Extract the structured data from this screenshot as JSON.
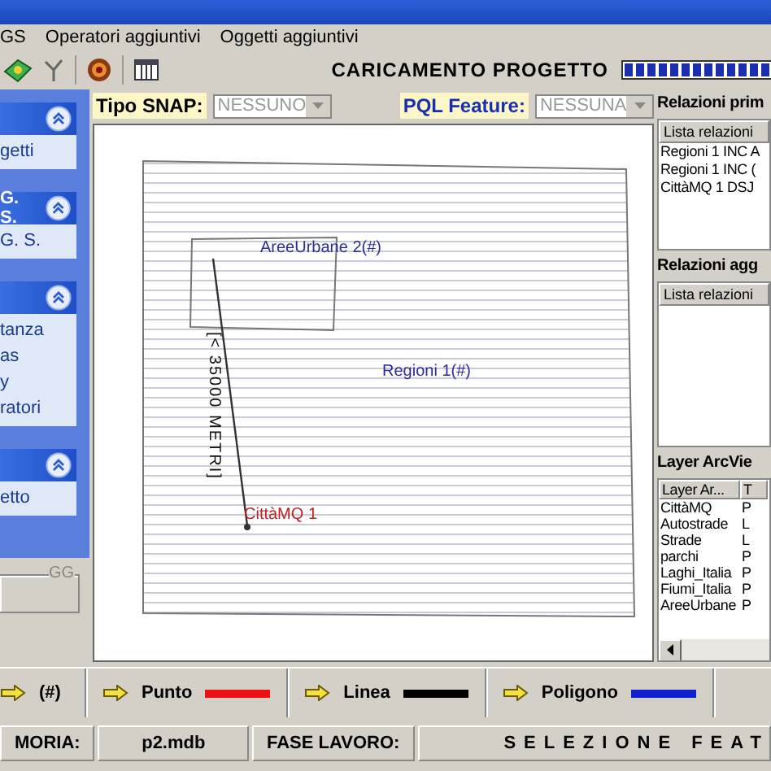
{
  "menu": [
    "GS",
    "Operatori aggiuntivi",
    "Oggetti aggiuntivi"
  ],
  "loading": {
    "label": "CARICAMENTO PROGETTO",
    "level": 1
  },
  "sidebar": {
    "groups": [
      {
        "items": [
          "getti"
        ]
      },
      {
        "title": "G. S.",
        "items": [
          "G. S."
        ]
      },
      {
        "items": [
          "tanza",
          "as",
          "y",
          "ratori"
        ]
      },
      {
        "items": [
          "etto"
        ]
      }
    ],
    "groupbox": {
      "label": "GG"
    }
  },
  "snap": {
    "label": "Tipo SNAP:",
    "value": "NESSUNO"
  },
  "pql": {
    "label": "PQL Feature:",
    "value": "NESSUNA"
  },
  "map": {
    "labels": [
      {
        "text": "AreeUrbane 2(#)",
        "color": "#2a2aa0"
      },
      {
        "text": "Regioni 1(#)",
        "color": "#2a2aa0"
      },
      {
        "text": "CittàMQ 1",
        "color": "#c02020"
      }
    ],
    "measure": "[< 35000 METRI]"
  },
  "relazioni_primarie": {
    "title": "Relazioni prim",
    "column": "Lista relazioni",
    "rows": [
      "Regioni 1 INC A",
      "Regioni 1 INC (",
      "CittàMQ 1 DSJ"
    ]
  },
  "relazioni_aggiuntive": {
    "title": "Relazioni agg",
    "column": "Lista relazioni"
  },
  "layers": {
    "title": "Layer ArcVie",
    "columns": [
      "Layer Ar...",
      "T"
    ],
    "rows": [
      [
        "CittàMQ",
        "P"
      ],
      [
        "Autostrade",
        "L"
      ],
      [
        "Strade",
        "L"
      ],
      [
        "parchi",
        "P"
      ],
      [
        "Laghi_Italia",
        "P"
      ],
      [
        "Fiumi_Italia",
        "P"
      ],
      [
        "AreeUrbane",
        "P"
      ]
    ]
  },
  "legend": [
    {
      "label": "(#)"
    },
    {
      "label": "Punto",
      "color": "#ee1111"
    },
    {
      "label": "Linea",
      "color": "#000000"
    },
    {
      "label": "Poligono",
      "color": "#1020d0"
    }
  ],
  "status": [
    {
      "text": "MORIA:",
      "kind": "label"
    },
    {
      "text": "p2.mdb",
      "kind": "value"
    },
    {
      "text": "FASE LAVORO:",
      "kind": "label"
    },
    {
      "text": "SELEZIONE FEAT",
      "kind": "phase"
    }
  ]
}
